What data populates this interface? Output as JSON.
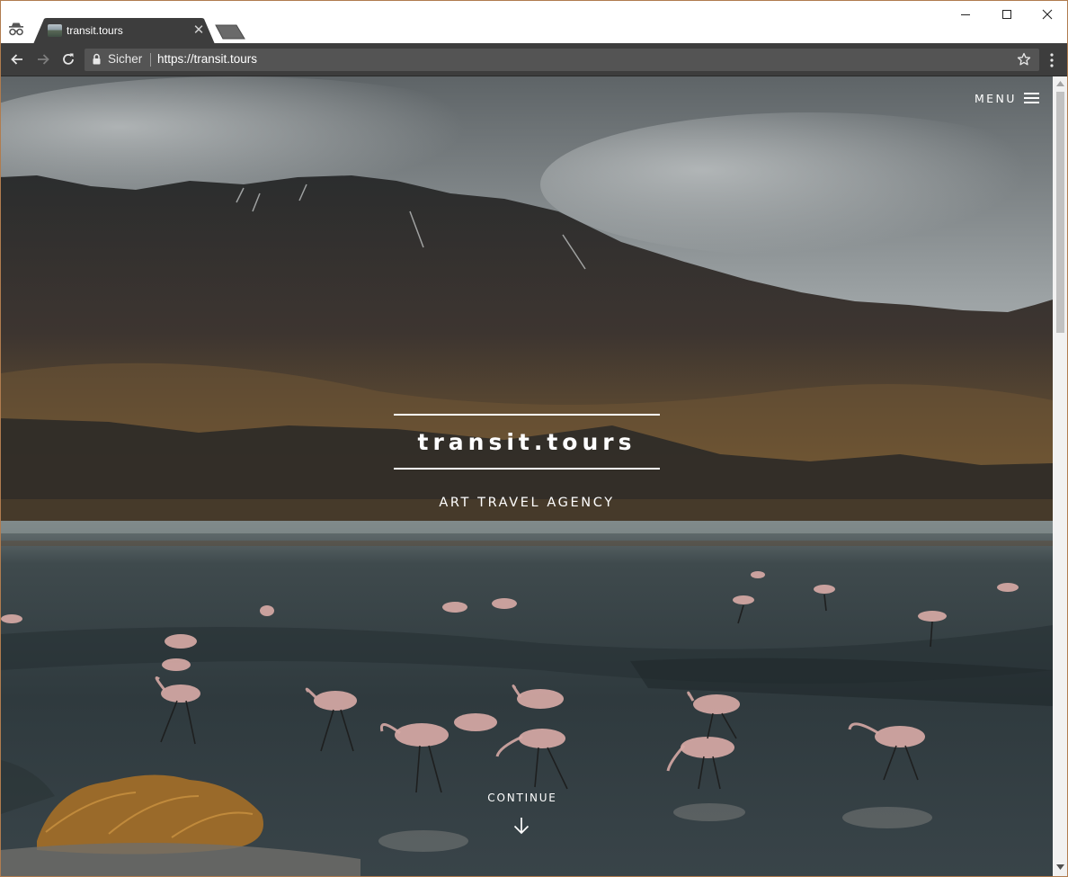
{
  "browser": {
    "tab": {
      "title": "transit.tours",
      "favicon": "site-favicon",
      "close_glyph": "✕"
    },
    "mode_icon": "incognito-icon",
    "window_controls": [
      "minimize-icon",
      "maximize-icon",
      "close-icon"
    ],
    "omnibox": {
      "security_label": "Sicher",
      "url": "https://transit.tours"
    },
    "toolbar_icons": [
      "back-arrow-icon",
      "forward-arrow-icon",
      "reload-icon",
      "lock-icon",
      "bookmark-star-icon",
      "menu-kebab-icon"
    ]
  },
  "page": {
    "menu_label": "MENU",
    "brand_name": "transit.tours",
    "tagline": "ART TRAVEL AGENCY",
    "continue_label": "CONTINUE",
    "hero_image": "mountain lake with flamingos"
  },
  "colors": {
    "toolbar": "#3d3d3d",
    "omnibox": "#545454",
    "text_on_hero": "#ffffff",
    "window_border": "#b07c4f"
  }
}
